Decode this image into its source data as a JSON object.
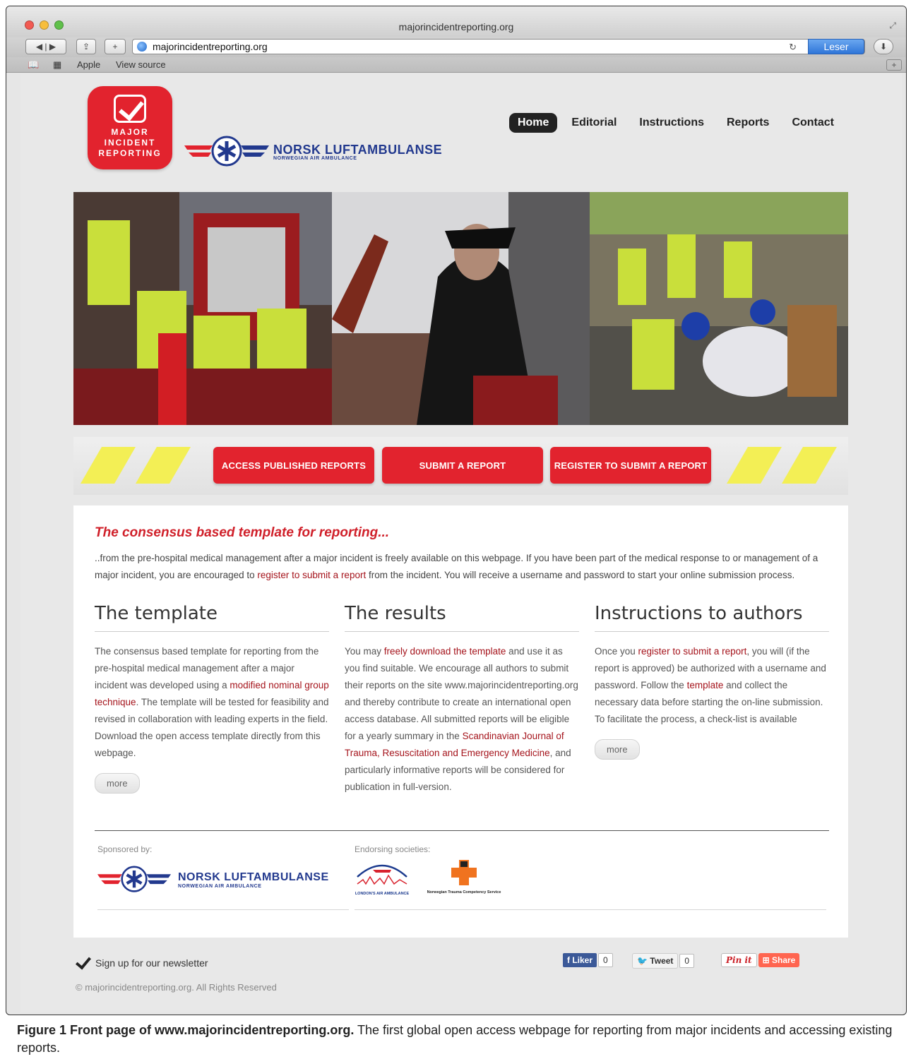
{
  "window": {
    "title": "majorincidentreporting.org",
    "url": "majorincidentreporting.org",
    "reader_label": "Leser",
    "bookmarks": [
      "Apple",
      "View source"
    ]
  },
  "logo": {
    "mir_lines": [
      "MAJOR",
      "INCIDENT",
      "REPORTING"
    ],
    "nla_name": "NORSK LUFTAMBULANSE",
    "nla_sub": "NORWEGIAN AIR AMBULANCE"
  },
  "nav": {
    "items": [
      "Home",
      "Editorial",
      "Instructions",
      "Reports",
      "Contact"
    ],
    "active": "Home"
  },
  "cta": {
    "access": "ACCESS PUBLISHED REPORTS",
    "submit": "SUBMIT A REPORT",
    "register": "REGISTER TO SUBMIT A REPORT"
  },
  "intro": {
    "title": "The consensus based template for reporting...",
    "text_1": "..from the pre-hospital medical management after a major incident is freely available on this webpage. If you have been part of the medical response to or management of a major incident, you are encouraged to ",
    "link": "register to submit a report",
    "text_2": " from the incident. You will receive a username and password to start your online submission process."
  },
  "columns": {
    "template": {
      "heading": "The template",
      "t1": "The consensus based template for reporting from the pre-hospital medical management after a major incident was developed using a ",
      "link": "modified nominal group technique",
      "t2": ". The template will be tested for feasibility and revised in collaboration with leading experts in the field. Download the open access template directly from this webpage.",
      "more": "more"
    },
    "results": {
      "heading": "The results",
      "t1": "You may ",
      "link1": "freely download the template",
      "t2": " and use it as you find suitable. We encourage all authors to submit their reports on the site www.majorincidentreporting.org and thereby contribute to create an international open access database. All submitted reports will be eligible for a yearly summary in the ",
      "link2": "Scandinavian Journal of Trauma, Resuscitation and Emergency Medicine",
      "t3": ", and particularly informative reports will be considered for publication in full-version."
    },
    "instructions": {
      "heading": "Instructions to authors",
      "t1": "Once you ",
      "link1": "register to submit a report",
      "t2": ", you will (if the report is approved) be authorized with a username and password. Follow the ",
      "link2": "template",
      "t3": " and collect the necessary data before starting the on-line submission. To facilitate the process, a check-list is available",
      "more": "more"
    }
  },
  "sponsors": {
    "sponsored_label": "Sponsored by:",
    "endorsing_label": "Endorsing societies:",
    "sponsor_name": "NORSK LUFTAMBULANSE",
    "sponsor_sub": "NORWEGIAN AIR AMBULANCE",
    "society_1": "LONDON'S AIR AMBULANCE",
    "society_2": "Norwegian Trauma Competency Service"
  },
  "footer": {
    "newsletter": "Sign up for our newsletter",
    "copyright": "© majorincidentreporting.org. All Rights Reserved",
    "fb_label": "Liker",
    "fb_count": "0",
    "tweet_label": "Tweet",
    "tweet_count": "0",
    "pin_label": "Pin it",
    "share_label": "Share"
  },
  "caption": {
    "bold": "Figure 1 Front page of www.majorincidentreporting.org.",
    "text": " The first global open access webpage for reporting from major incidents and accessing existing reports."
  },
  "colors": {
    "brand_red": "#e2232e",
    "link_red": "#a5141c",
    "nla_blue": "#22398e",
    "stripe_yellow": "#f3ef55"
  }
}
